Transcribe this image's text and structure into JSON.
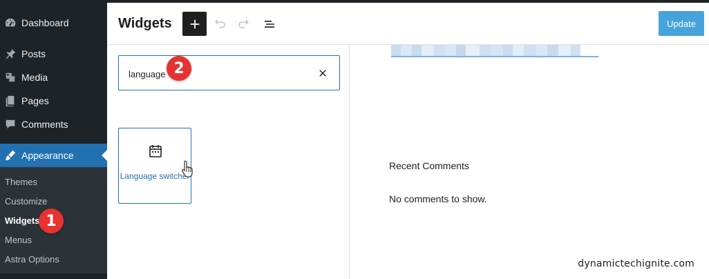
{
  "sidebar": {
    "items": [
      {
        "label": "Dashboard",
        "icon": "dashboard-icon"
      },
      {
        "label": "Posts",
        "icon": "pin-icon"
      },
      {
        "label": "Media",
        "icon": "media-icon"
      },
      {
        "label": "Pages",
        "icon": "pages-icon"
      },
      {
        "label": "Comments",
        "icon": "comment-icon"
      },
      {
        "label": "Appearance",
        "icon": "brush-icon"
      }
    ],
    "submenu": [
      {
        "label": "Themes"
      },
      {
        "label": "Customize"
      },
      {
        "label": "Widgets"
      },
      {
        "label": "Menus"
      },
      {
        "label": "Astra Options"
      }
    ]
  },
  "header": {
    "title": "Widgets",
    "update_label": "Update"
  },
  "inserter": {
    "search_value": "language",
    "block": {
      "label": "Language switcher",
      "icon": "calendar-icon"
    }
  },
  "canvas": {
    "widget_title": "Recent Comments",
    "empty_text": "No comments to show."
  },
  "badges": {
    "step1": "1",
    "step2": "2"
  },
  "watermark": "dynamictechignite.com",
  "colors": {
    "sidebar_bg": "#1d2327",
    "accent": "#2271b1",
    "update_btn": "#3399d6",
    "badge": "#e8322f"
  }
}
